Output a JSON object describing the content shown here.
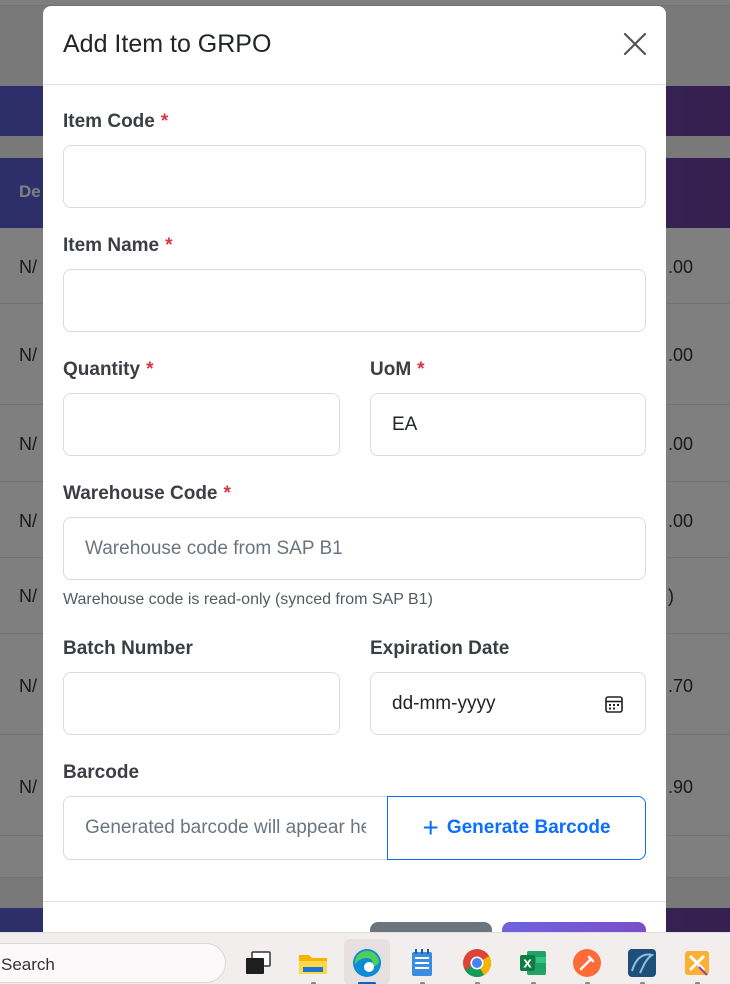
{
  "background": {
    "table_header_partial": "De",
    "rows": [
      {
        "left": "N/",
        "right": ".00"
      },
      {
        "left": "N/",
        "right": ".00"
      },
      {
        "left": "N/",
        "right": ".00"
      },
      {
        "left": "N/",
        "right": ".00"
      },
      {
        "left": "N/",
        "right": ")"
      },
      {
        "left": "N/",
        "right": ".70"
      },
      {
        "left": "N/",
        "right": ".90"
      }
    ]
  },
  "modal": {
    "title": "Add Item to GRPO",
    "fields": {
      "item_code": {
        "label": "Item Code",
        "required_mark": "*",
        "value": ""
      },
      "item_name": {
        "label": "Item Name",
        "required_mark": "*",
        "value": ""
      },
      "quantity": {
        "label": "Quantity",
        "required_mark": "*",
        "value": ""
      },
      "uom": {
        "label": "UoM",
        "required_mark": "*",
        "value": "EA"
      },
      "warehouse_code": {
        "label": "Warehouse Code",
        "required_mark": "*",
        "placeholder": "Warehouse code from SAP B1",
        "help": "Warehouse code is read-only (synced from SAP B1)"
      },
      "batch_number": {
        "label": "Batch Number",
        "value": ""
      },
      "expiration_date": {
        "label": "Expiration Date",
        "placeholder": "dd-mm-yyyy"
      },
      "barcode": {
        "label": "Barcode",
        "placeholder": "Generated barcode will appear here",
        "button_label": "Generate Barcode"
      }
    }
  },
  "taskbar": {
    "search_placeholder": "Search",
    "apps": [
      "task-view",
      "file-explorer",
      "edge",
      "notepad",
      "chrome",
      "excel",
      "postman",
      "mysql-workbench",
      "xampp"
    ]
  },
  "colors": {
    "accent": "#0d6efd",
    "required": "#dc3545",
    "header_gradient_start": "#5b5fd6",
    "header_gradient_end": "#6b3fa0"
  }
}
